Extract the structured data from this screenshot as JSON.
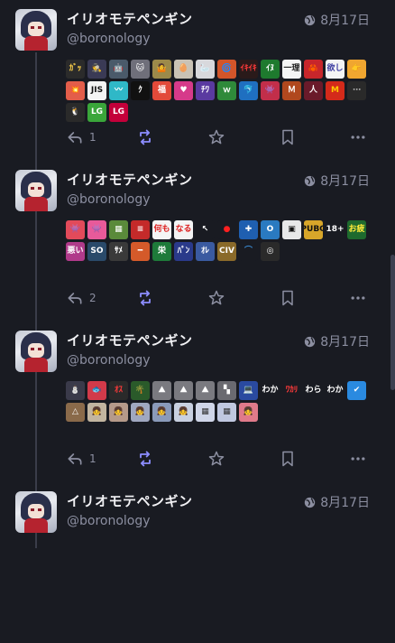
{
  "colors": {
    "background": "#191b22",
    "name": "#f2f2f5",
    "muted": "#8c8fa1",
    "boost": "#8c8dff",
    "thread_line": "#3a3d4a"
  },
  "posts": [
    {
      "display_name": "イリオモテペンギン",
      "handle": "@boronology",
      "date": "8月17日",
      "visibility_icon": "globe-icon",
      "reply_count": "1",
      "emojis": [
        {
          "text": "ｶﾞｯ",
          "bg": "#2b2b2b",
          "fg": "#ffd24a"
        },
        {
          "text": "🕵",
          "bg": "#3a3a55",
          "fg": "#fff"
        },
        {
          "text": "🤖",
          "bg": "#4a5a6a",
          "fg": "#fff"
        },
        {
          "text": "🐱",
          "bg": "#6f6f7a",
          "fg": "#fff"
        },
        {
          "text": "🤷",
          "bg": "#9c8a4a",
          "fg": "#fff"
        },
        {
          "text": "🥚",
          "bg": "#c9c2b5",
          "fg": "#333"
        },
        {
          "text": "🦢",
          "bg": "#d8d8dc",
          "fg": "#333"
        },
        {
          "text": "🌀",
          "bg": "#d2552a",
          "fg": "#fff"
        },
        {
          "text": "ｲｷｲｷ",
          "bg": "#2a1a1a",
          "fg": "#ff3a3a"
        },
        {
          "text": "ｲﾇ",
          "bg": "#1e7a2e",
          "fg": "#fff"
        },
        {
          "text": "一理",
          "bg": "#f4f4f4",
          "fg": "#1a1a1a"
        },
        {
          "text": "🦀",
          "bg": "#c7262b",
          "fg": "#fff"
        },
        {
          "text": "欲し",
          "bg": "#f4f4f4",
          "fg": "#3a3aa0"
        },
        {
          "text": "👉",
          "bg": "#f0a630",
          "fg": "#fff"
        },
        {
          "text": "💥",
          "bg": "#e35d4a",
          "fg": "#fff"
        },
        {
          "text": "JIS",
          "bg": "#f4f4f4",
          "fg": "#111"
        },
        {
          "text": "〰",
          "bg": "#2fb8c7",
          "fg": "#fff"
        },
        {
          "text": "ｸ",
          "bg": "#111",
          "fg": "#fff"
        },
        {
          "text": "福",
          "bg": "#e24a3a",
          "fg": "#fff"
        },
        {
          "text": "♥",
          "bg": "#d63a8a",
          "fg": "#fff"
        },
        {
          "text": "ﾁﾜ",
          "bg": "#5a3aa0",
          "fg": "#fff"
        },
        {
          "text": "ｗ",
          "bg": "#2f8a3a",
          "fg": "#fff"
        },
        {
          "text": "🐬",
          "bg": "#1f6fc0",
          "fg": "#fff"
        },
        {
          "text": "👾",
          "bg": "#c22e4a",
          "fg": "#fff"
        },
        {
          "text": "Ｍ",
          "bg": "#b0481e",
          "fg": "#fff"
        },
        {
          "text": "人",
          "bg": "#6a1a2a",
          "fg": "#fff"
        },
        {
          "text": "M",
          "bg": "#d42a1a",
          "fg": "#ffcc00"
        },
        {
          "text": "⋯",
          "bg": "#2a2a2a",
          "fg": "#aaa"
        },
        {
          "text": "🐧",
          "bg": "#2a2a2a",
          "fg": "#fff"
        },
        {
          "text": "LG",
          "bg": "#3aa63a",
          "fg": "#fff"
        },
        {
          "text": "LG",
          "bg": "#c4003a",
          "fg": "#fff"
        }
      ]
    },
    {
      "display_name": "イリオモテペンギン",
      "handle": "@boronology",
      "date": "8月17日",
      "visibility_icon": "globe-icon",
      "reply_count": "2",
      "emojis": [
        {
          "text": "👾",
          "bg": "#e24a5a",
          "fg": "#fff"
        },
        {
          "text": "👾",
          "bg": "#e85a9a",
          "fg": "#fff"
        },
        {
          "text": "▦",
          "bg": "#5a8a3a",
          "fg": "#fff"
        },
        {
          "text": "≡",
          "bg": "#c42a2a",
          "fg": "#fff"
        },
        {
          "text": "何も",
          "bg": "#f4f4f4",
          "fg": "#d22"
        },
        {
          "text": "なる",
          "bg": "#f4f4f4",
          "fg": "#d22"
        },
        {
          "text": "↖",
          "bg": "#191b22",
          "fg": "#fff"
        },
        {
          "text": "●",
          "bg": "#191b22",
          "fg": "#ff2020"
        },
        {
          "text": "✚",
          "bg": "#1f5fb0",
          "fg": "#fff"
        },
        {
          "text": "O",
          "bg": "#2a7ac0",
          "fg": "#fff"
        },
        {
          "text": "▣",
          "bg": "#e8e8e8",
          "fg": "#111"
        },
        {
          "text": "PUBG",
          "bg": "#d8a62a",
          "fg": "#111"
        },
        {
          "text": "18+",
          "bg": "#191b22",
          "fg": "#fff"
        },
        {
          "text": "お疲",
          "bg": "#1e6a2e",
          "fg": "#ffea3a"
        },
        {
          "text": "悪い",
          "bg": "#b03a8a",
          "fg": "#fff"
        },
        {
          "text": "SO",
          "bg": "#2a4a6a",
          "fg": "#fff"
        },
        {
          "text": "ｻﾒ",
          "bg": "#3a3a3a",
          "fg": "#fff"
        },
        {
          "text": "━",
          "bg": "#d45a2a",
          "fg": "#fff"
        },
        {
          "text": "栄",
          "bg": "#1e7a3a",
          "fg": "#fff"
        },
        {
          "text": "ﾊﾟﾝ",
          "bg": "#2a3a8a",
          "fg": "#fff"
        },
        {
          "text": "ｵﾚ",
          "bg": "#3a5aa0",
          "fg": "#fff"
        },
        {
          "text": "CIV",
          "bg": "#8a6a2a",
          "fg": "#fff"
        },
        {
          "text": "⌒",
          "bg": "#191b22",
          "fg": "#3a8ad2"
        },
        {
          "text": "◎",
          "bg": "#2a2a2a",
          "fg": "#fff"
        }
      ]
    },
    {
      "display_name": "イリオモテペンギン",
      "handle": "@boronology",
      "date": "8月17日",
      "visibility_icon": "globe-icon",
      "reply_count": "1",
      "emojis": [
        {
          "text": "⛄",
          "bg": "#3a3a4a",
          "fg": "#fff"
        },
        {
          "text": "🐟",
          "bg": "#d23a4a",
          "fg": "#fff"
        },
        {
          "text": "ｵｽ",
          "bg": "#2a2a2a",
          "fg": "#ff3a3a"
        },
        {
          "text": "🌴",
          "bg": "#2a5a2a",
          "fg": "#fff"
        },
        {
          "text": "⛰",
          "bg": "#7a7a80",
          "fg": "#fff"
        },
        {
          "text": "⛰",
          "bg": "#7a7a80",
          "fg": "#fff"
        },
        {
          "text": "⛰",
          "bg": "#7a7a80",
          "fg": "#fff"
        },
        {
          "text": "▚",
          "bg": "#6a6a70",
          "fg": "#fff"
        },
        {
          "text": "💻",
          "bg": "#2a4aa0",
          "fg": "#fff"
        },
        {
          "text": "わか",
          "bg": "#191b22",
          "fg": "#fff"
        },
        {
          "text": "ﾜｶﾘ",
          "bg": "#191b22",
          "fg": "#ff3a3a"
        },
        {
          "text": "わら",
          "bg": "#191b22",
          "fg": "#fff"
        },
        {
          "text": "わか",
          "bg": "#191b22",
          "fg": "#fff"
        },
        {
          "text": "✔",
          "bg": "#2a8ae0",
          "fg": "#fff"
        },
        {
          "text": "△",
          "bg": "#8a6a4a",
          "fg": "#fff"
        },
        {
          "text": "👧",
          "bg": "#c2b5a0",
          "fg": "#333"
        },
        {
          "text": "👧",
          "bg": "#b59a8a",
          "fg": "#333"
        },
        {
          "text": "👧",
          "bg": "#a0a8c0",
          "fg": "#333"
        },
        {
          "text": "👧",
          "bg": "#8a9aba",
          "fg": "#333"
        },
        {
          "text": "👧",
          "bg": "#c8d0e0",
          "fg": "#333"
        },
        {
          "text": "▦",
          "bg": "#d0d6e8",
          "fg": "#333"
        },
        {
          "text": "▦",
          "bg": "#c0c8e0",
          "fg": "#333"
        },
        {
          "text": "👧",
          "bg": "#e07a8a",
          "fg": "#fff"
        }
      ]
    },
    {
      "display_name": "イリオモテペンギン",
      "handle": "@boronology",
      "date": "8月17日",
      "visibility_icon": "globe-icon",
      "reply_count": "",
      "emojis": []
    }
  ]
}
